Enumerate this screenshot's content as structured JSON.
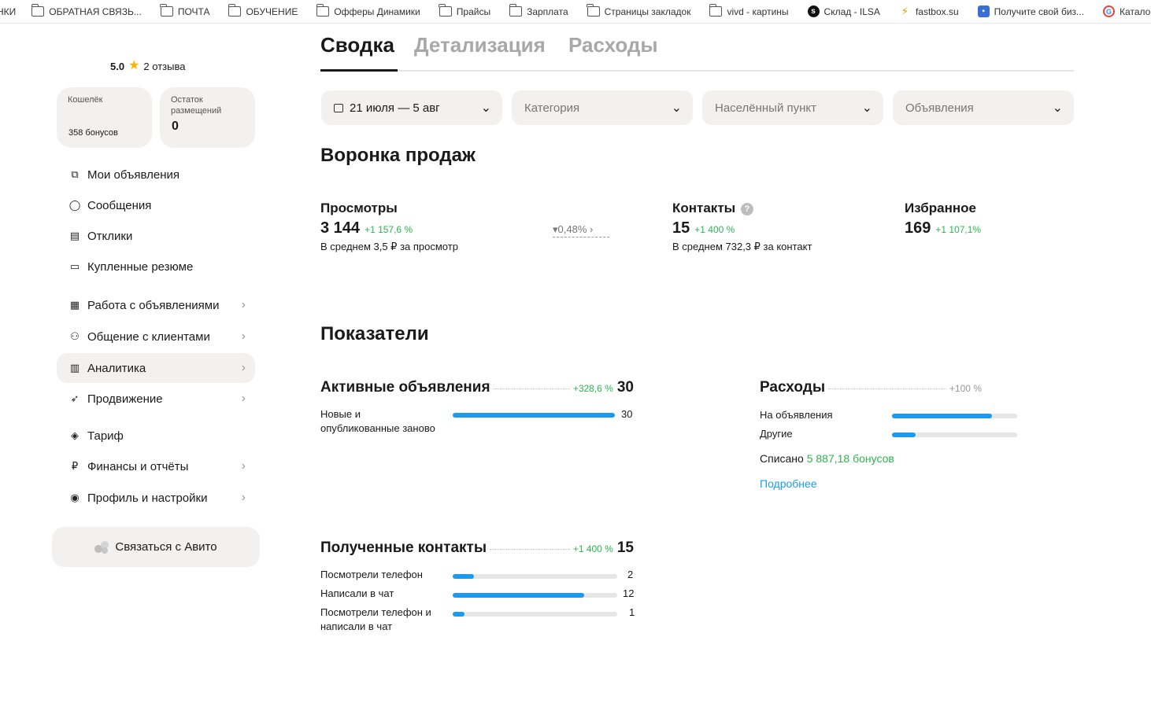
{
  "bookmarks": [
    {
      "label": "НКИ",
      "icon": "none"
    },
    {
      "label": "ОБРАТНАЯ СВЯЗЬ...",
      "icon": "folder-icon"
    },
    {
      "label": "ПОЧТА",
      "icon": "folder-icon"
    },
    {
      "label": "ОБУЧЕНИЕ",
      "icon": "folder-icon"
    },
    {
      "label": "Офферы Динамики",
      "icon": "folder-icon"
    },
    {
      "label": "Прайсы",
      "icon": "folder-icon"
    },
    {
      "label": "Зарплата",
      "icon": "folder-icon"
    },
    {
      "label": "Страницы закладок",
      "icon": "folder-icon"
    },
    {
      "label": "vivd - картины",
      "icon": "folder-icon"
    },
    {
      "label": "Склад - ILSA",
      "icon": "symfony-icon"
    },
    {
      "label": "fastbox.su",
      "icon": "lightning-icon"
    },
    {
      "label": "Получите свой биз...",
      "icon": "business-icon"
    },
    {
      "label": "Каталог: Google",
      "icon": "google-icon"
    }
  ],
  "sidebar": {
    "rating_score": "5.0",
    "rating_reviews": "2 отзыва",
    "wallet": {
      "label": "Кошелёк",
      "value": "358 бонусов"
    },
    "placements": {
      "label": "Остаток размещений",
      "value": "0"
    },
    "nav": [
      {
        "label": "Мои объявления",
        "icon": "ads-icon",
        "chevron": false
      },
      {
        "label": "Сообщения",
        "icon": "message-icon",
        "chevron": false
      },
      {
        "label": "Отклики",
        "icon": "responses-icon",
        "chevron": false
      },
      {
        "label": "Купленные резюме",
        "icon": "resume-icon",
        "chevron": false
      },
      {
        "label": "Работа с объявлениями",
        "icon": "ads-work-icon",
        "chevron": true
      },
      {
        "label": "Общение с клиентами",
        "icon": "clients-icon",
        "chevron": true
      },
      {
        "label": "Аналитика",
        "icon": "analytics-icon",
        "chevron": true,
        "active": true
      },
      {
        "label": "Продвижение",
        "icon": "rocket-icon",
        "chevron": true
      },
      {
        "label": "Тариф",
        "icon": "tariff-icon",
        "chevron": false
      },
      {
        "label": "Финансы и отчёты",
        "icon": "ruble-icon",
        "chevron": true
      },
      {
        "label": "Профиль и настройки",
        "icon": "profile-icon",
        "chevron": true
      }
    ],
    "contact_button": "Связаться с Авито"
  },
  "tabs": [
    {
      "label": "Сводка",
      "active": true
    },
    {
      "label": "Детализация",
      "active": false
    },
    {
      "label": "Расходы",
      "active": false
    }
  ],
  "filters": {
    "date": "21 июля — 5 авг",
    "category": "Категория",
    "location": "Населённый пункт",
    "ads": "Объявления"
  },
  "funnel": {
    "title": "Воронка продаж",
    "views": {
      "title": "Просмотры",
      "value": "3 144",
      "delta": "+1 157,6 %",
      "sub": "В среднем 3,5 ₽ за просмотр"
    },
    "conversion": "0,48%",
    "contacts": {
      "title": "Контакты",
      "value": "15",
      "delta": "+1 400 %",
      "sub": "В среднем 732,3 ₽ за контакт"
    },
    "favorites": {
      "title": "Избранное",
      "value": "169",
      "delta": "+1 107,1%"
    }
  },
  "indicators": {
    "title": "Показатели",
    "active_ads": {
      "title": "Активные объявления",
      "delta": "+328,6 %",
      "value": "30",
      "rows": [
        {
          "label": "Новые и опубликованные заново",
          "value": "30",
          "fraction": 1.0
        }
      ]
    },
    "expenses": {
      "title": "Расходы",
      "delta": "+100 %",
      "rows": [
        {
          "label": "На объявления",
          "fraction": 0.8
        },
        {
          "label": "Другие",
          "fraction": 0.19
        }
      ],
      "spent_label": "Списано",
      "spent_value": "5 887,18 бонусов",
      "more": "Подробнее"
    },
    "contacts": {
      "title": "Полученные контакты",
      "delta": "+1 400 %",
      "value": "15",
      "rows": [
        {
          "label": "Посмотрели телефон",
          "value": "2",
          "fraction": 0.13
        },
        {
          "label": "Написали в чат",
          "value": "12",
          "fraction": 0.8
        },
        {
          "label": "Посмотрели телефон и написали в чат",
          "value": "1",
          "fraction": 0.07
        }
      ]
    }
  }
}
